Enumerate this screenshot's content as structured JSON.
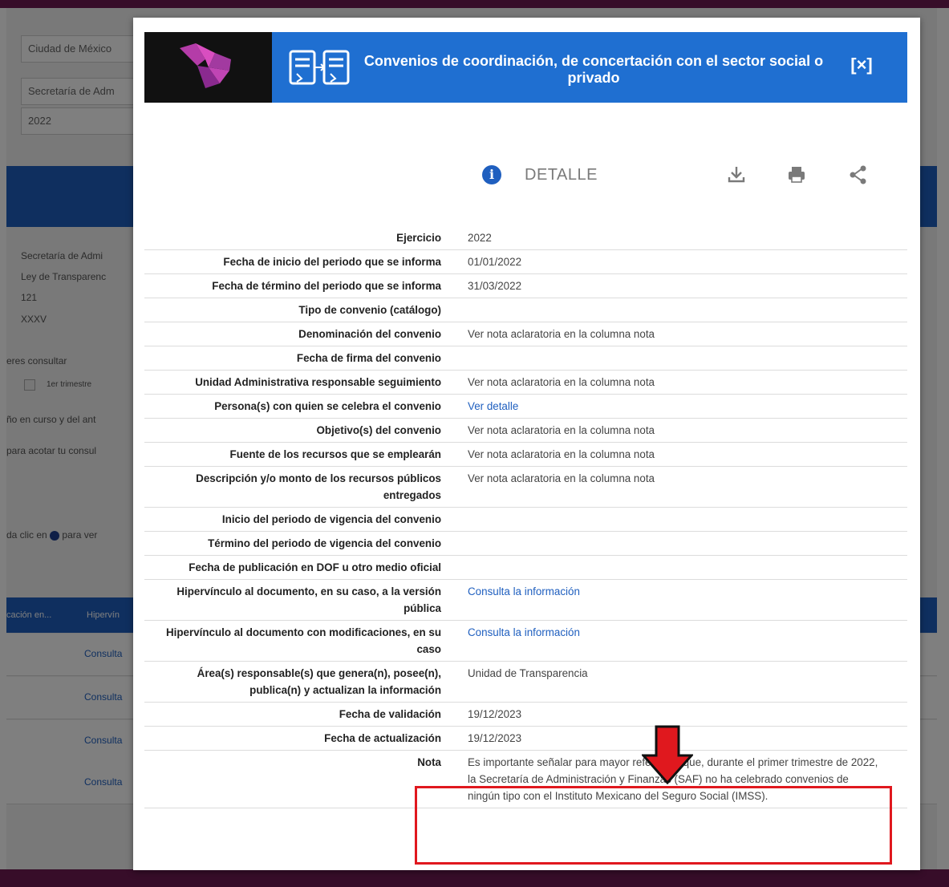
{
  "background": {
    "selects": [
      "Ciudad de México",
      "Secretaría de Adm",
      "2022"
    ],
    "info_lines": [
      "Secretaría de Admi",
      "Ley de Transparenc",
      "121",
      "XXXV"
    ],
    "consult_label": "eres consultar",
    "checkbox_label": "1er trimestre",
    "year_text": "ño en curso y del ant",
    "filter_text": "para acotar tu consul",
    "click_hint_prefix": "da clic en",
    "click_hint_suffix": "para ver",
    "table_headers": [
      "cación en...",
      "Hipervín"
    ],
    "row_links": [
      "Consulta",
      "Consulta",
      "Consulta",
      "Consulta"
    ]
  },
  "modal": {
    "title": "Convenios de coordinación, de concertación con el sector social o privado",
    "close_label": "[×]",
    "toolbar": {
      "detalle_label": "DETALLE",
      "info_icon": "i",
      "icons": [
        "download-icon",
        "print-icon",
        "share-icon"
      ]
    },
    "rows": [
      {
        "label": "Ejercicio",
        "value": "2022"
      },
      {
        "label": "Fecha de inicio del periodo que se informa",
        "value": "01/01/2022"
      },
      {
        "label": "Fecha de término del periodo que se informa",
        "value": "31/03/2022"
      },
      {
        "label": "Tipo de convenio (catálogo)",
        "value": ""
      },
      {
        "label": "Denominación del convenio",
        "value": "Ver nota aclaratoria en la columna nota"
      },
      {
        "label": "Fecha de firma del convenio",
        "value": ""
      },
      {
        "label": "Unidad Administrativa responsable seguimiento",
        "value": "Ver nota aclaratoria en la columna nota"
      },
      {
        "label": "Persona(s) con quien se celebra el convenio",
        "value": "Ver detalle",
        "link": true
      },
      {
        "label": "Objetivo(s) del convenio",
        "value": "Ver nota aclaratoria en la columna nota"
      },
      {
        "label": "Fuente de los recursos que se emplearán",
        "value": "Ver nota aclaratoria en la columna nota"
      },
      {
        "label": "Descripción y/o monto de los recursos públicos entregados",
        "value": "Ver nota aclaratoria en la columna nota"
      },
      {
        "label": "Inicio del periodo de vigencia del convenio",
        "value": ""
      },
      {
        "label": "Término del periodo de vigencia del convenio",
        "value": ""
      },
      {
        "label": "Fecha de publicación en DOF u otro medio oficial",
        "value": ""
      },
      {
        "label": "Hipervínculo al documento, en su caso, a la versión pública",
        "value": "Consulta la información",
        "link": true
      },
      {
        "label": "Hipervínculo al documento con modificaciones, en su caso",
        "value": "Consulta la información",
        "link": true
      },
      {
        "label": "Área(s) responsable(s) que genera(n), posee(n), publica(n) y actualizan la información",
        "value": "Unidad de Transparencia"
      },
      {
        "label": "Fecha de validación",
        "value": "19/12/2023"
      },
      {
        "label": "Fecha de actualización",
        "value": "19/12/2023"
      },
      {
        "label": "Nota",
        "value": "Es importante señalar para mayor referencia que, durante el primer trimestre de 2022, la Secretaría de Administración y Finanzas (SAF) no ha celebrado convenios de ningún tipo con el Instituto Mexicano del Seguro Social (IMSS)."
      }
    ]
  },
  "colors": {
    "brand_purple": "#6e1a52",
    "header_blue": "#1f6fd1",
    "link_blue": "#1f5fbf",
    "highlight_red": "#e0181e"
  }
}
